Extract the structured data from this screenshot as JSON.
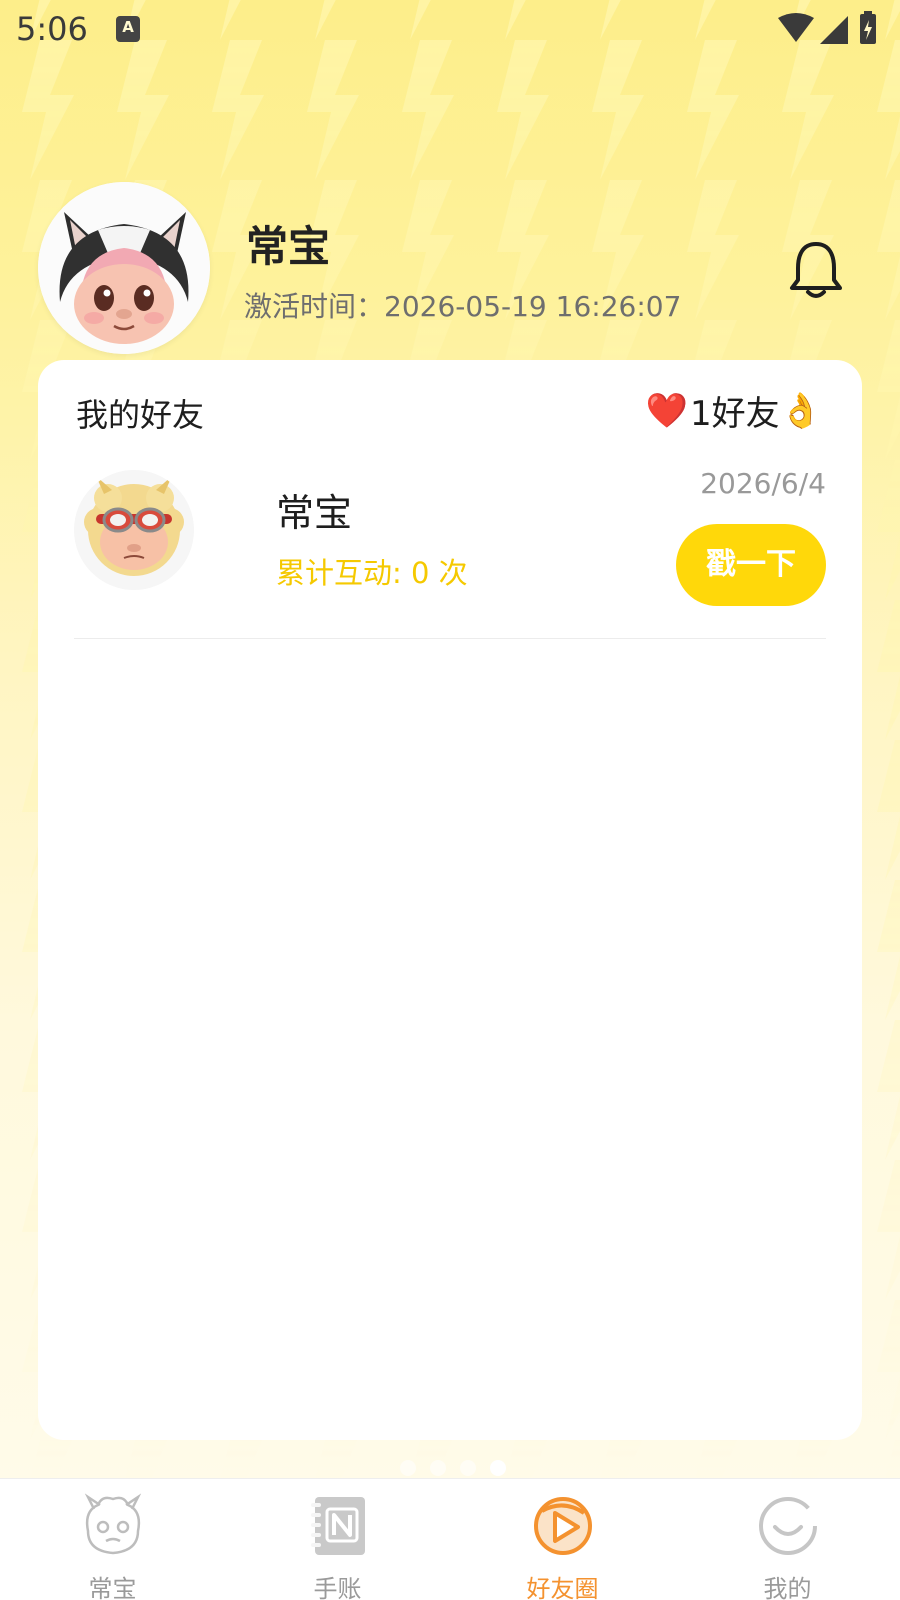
{
  "status_bar": {
    "time": "5:06",
    "notification_icon": "A"
  },
  "profile": {
    "name": "常宝",
    "activation_label": "激活时间：",
    "activation_time": "2026-05-19 16:26:07"
  },
  "friends_card": {
    "title": "我的好友",
    "count_heart": "❤️",
    "count_text": "1好友",
    "count_emoji": "👌",
    "friends": [
      {
        "name": "常宝",
        "interactions": "累计互动: 0 次",
        "date": "2026/6/4",
        "poke_label": "戳一下"
      }
    ]
  },
  "bottom_nav": {
    "items": [
      {
        "label": "常宝",
        "icon": "dragon-mascot-icon",
        "active": false
      },
      {
        "label": "手账",
        "icon": "notebook-icon",
        "active": false
      },
      {
        "label": "好友圈",
        "icon": "friends-circle-play-icon",
        "active": true
      },
      {
        "label": "我的",
        "icon": "smile-circle-icon",
        "active": false
      }
    ]
  },
  "colors": {
    "accent_yellow": "#ffd80a",
    "interaction_text": "#f5c900",
    "nav_active": "#f4922f",
    "nav_inactive": "#9a9a9a"
  }
}
